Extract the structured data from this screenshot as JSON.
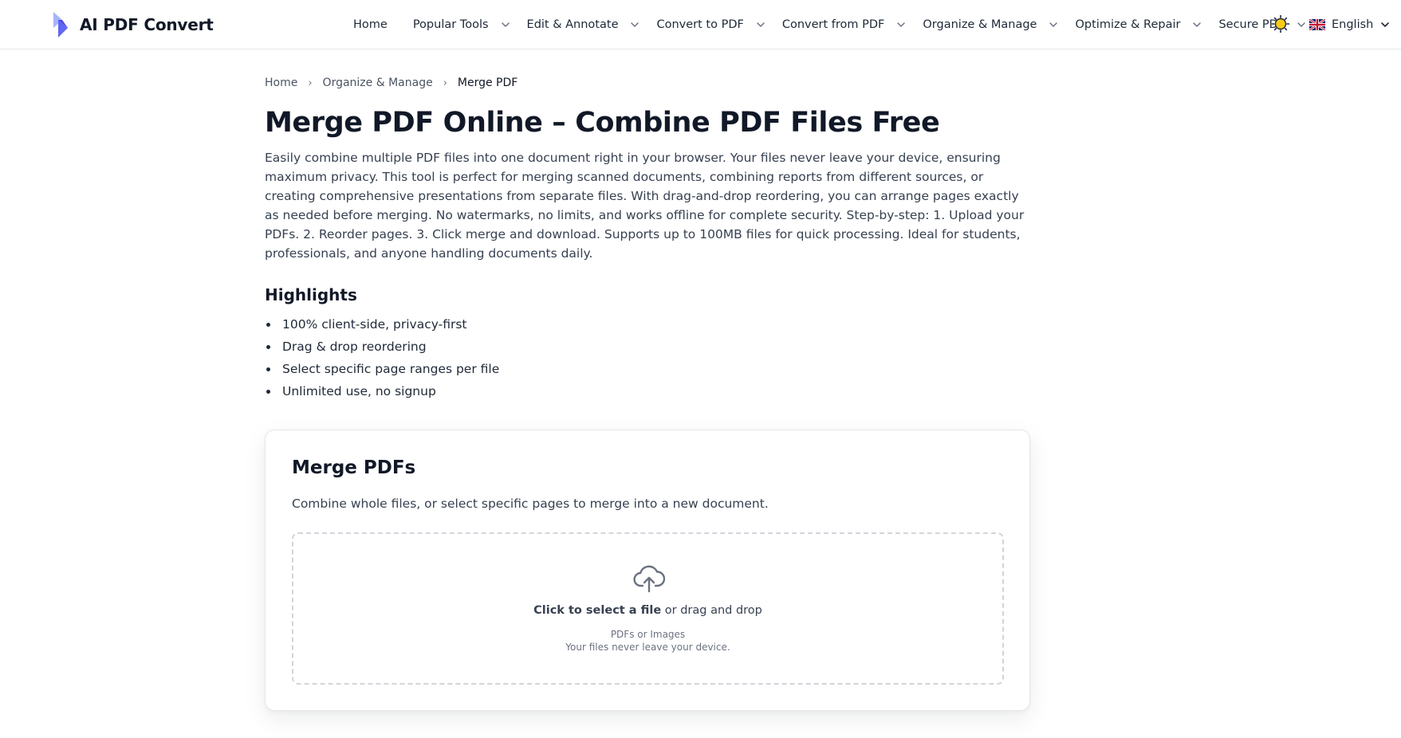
{
  "brand": {
    "name": "AI PDF Convert",
    "logo_colors": [
      "#a5b4fc",
      "#6366f1",
      "#4f46e5"
    ]
  },
  "nav": {
    "items": [
      {
        "label": "Home",
        "has_dropdown": false
      },
      {
        "label": "Popular Tools",
        "has_dropdown": true
      },
      {
        "label": "Edit & Annotate",
        "has_dropdown": true
      },
      {
        "label": "Convert to PDF",
        "has_dropdown": true
      },
      {
        "label": "Convert from PDF",
        "has_dropdown": true
      },
      {
        "label": "Organize & Manage",
        "has_dropdown": true
      },
      {
        "label": "Optimize & Repair",
        "has_dropdown": true
      },
      {
        "label": "Secure PDF",
        "has_dropdown": true
      }
    ],
    "theme_icon": "sun-icon",
    "theme_color": "#facc15",
    "language": {
      "label": "English",
      "flag_icon": "uk-flag-icon"
    }
  },
  "breadcrumb": {
    "items": [
      "Home",
      "Organize & Manage"
    ],
    "separator": "›",
    "current": "Merge PDF"
  },
  "page": {
    "title": "Merge PDF Online – Combine PDF Files Free",
    "intro": "Easily combine multiple PDF files into one document right in your browser. Your files never leave your device, ensuring maximum privacy. This tool is perfect for merging scanned documents, combining reports from different sources, or creating comprehensive presentations from separate files. With drag-and-drop reordering, you can arrange pages exactly as needed before merging. No watermarks, no limits, and works offline for complete security. Step-by-step: 1. Upload your PDFs. 2. Reorder pages. 3. Click merge and download. Supports up to 100MB files for quick processing. Ideal for students, professionals, and anyone handling documents daily."
  },
  "highlights": {
    "title": "Highlights",
    "items": [
      "100% client-side, privacy-first",
      "Drag & drop reordering",
      "Select specific page ranges per file",
      "Unlimited use, no signup"
    ]
  },
  "tool": {
    "title": "Merge PDFs",
    "description": "Combine whole files, or select specific pages to merge into a new document.",
    "dropzone": {
      "icon": "cloud-upload-icon",
      "cta_strong": "Click to select a file",
      "cta_rest": " or drag and drop",
      "accepted": "PDFs or Images",
      "privacy": "Your files never leave your device."
    }
  }
}
